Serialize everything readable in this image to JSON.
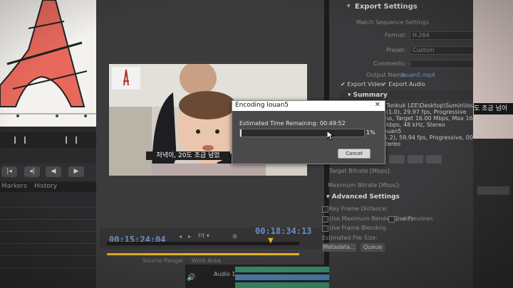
{
  "left_panel": {
    "tabs": [
      "Markers",
      "History"
    ]
  },
  "monitor": {
    "subtitle": "저녁이, 20도 조금 넘었",
    "timecode_current": "00:15:24:04",
    "timecode_total": "00:18:34:13",
    "fit_label": "Fit",
    "source_range_label": "Source Range:",
    "work_area_label": "Work Area"
  },
  "timeline": {
    "audio_track": "Audio 1"
  },
  "export_panel": {
    "title": "Export Settings",
    "match_sequence_label": "Match Sequence Settings",
    "format_label": "Format:",
    "format_value": "H.264",
    "preset_label": "Preset:",
    "preset_value": "Custom",
    "comments_label": "Comments:",
    "output_name_label": "Output Name:",
    "output_name_value": "louan5.mp4",
    "export_video_label": "Export Video",
    "export_audio_label": "Export Audio",
    "summary_title": "Summary",
    "summary_lines": [
      "Tonkuk LEE\\Desktop\\Sumin\\louan5.mp4",
      "(1.0), 29.97 fps, Progressive",
      "ss, Target 16.00 Mbps, Max 16.00 Mbps",
      "kbps, 48 kHz, Stereo",
      "louan5",
      "(1.2), 59.94 fps, Progressive, 00:18:34:13",
      "Stereo"
    ],
    "target_bitrate_label": "Target Bitrate [Mbps]:",
    "max_bitrate_label": "Maximum Bitrate [Mbps]:",
    "advanced_title": "Advanced Settings",
    "key_frame_label": "Key Frame Distance:",
    "use_max_render_label": "Use Maximum Render Quality",
    "use_previews_label": "Use Previews",
    "use_frame_blending_label": "Use Frame Blending",
    "estimated_size_label": "Estimated File Size:",
    "metadata_label": "Metadata...",
    "queue_label": "Queue"
  },
  "right_window": {
    "subtitle": "도 조금 넘어"
  },
  "dialog": {
    "title": "Encoding louan5",
    "estimated_time_label": "Estimated Time Remaining: 00:49:52",
    "progress_percent": 1,
    "progress_text": "1%",
    "cancel_label": "Cancel"
  },
  "colors": {
    "timecode": "#6d8dc4",
    "work_area": "#e6b31e",
    "eiffel": "#e8695c"
  }
}
